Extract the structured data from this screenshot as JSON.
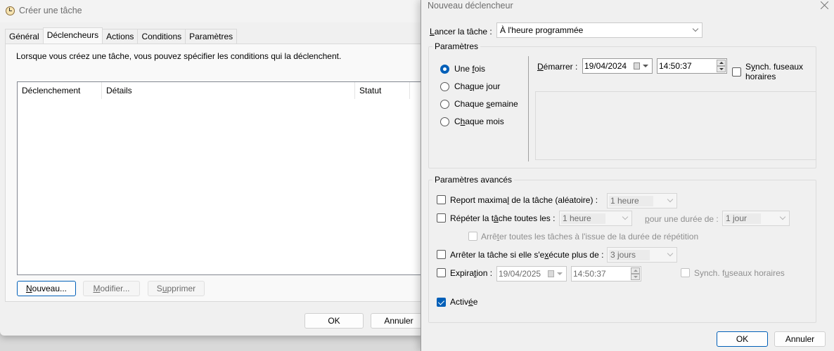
{
  "create_task_window": {
    "title": "Créer une tâche",
    "tabs": [
      {
        "label": "Général",
        "active": false
      },
      {
        "label": "Déclencheurs",
        "active": true
      },
      {
        "label": "Actions",
        "active": false
      },
      {
        "label": "Conditions",
        "active": false
      },
      {
        "label": "Paramètres",
        "active": false
      }
    ],
    "description": "Lorsque vous créez une tâche, vous pouvez spécifier les conditions qui la déclenchent.",
    "table": {
      "columns": [
        "Déclenchement",
        "Détails",
        "Statut"
      ],
      "rows": []
    },
    "buttons": {
      "new": {
        "prefix": "",
        "mnemonic": "N",
        "rest": "ouveau..."
      },
      "edit": {
        "prefix": "",
        "mnemonic": "M",
        "rest": "odifier..."
      },
      "delete": {
        "prefix": "S",
        "mnemonic": "u",
        "rest": "pprimer"
      },
      "ok": "OK",
      "cancel": "Annuler"
    }
  },
  "new_trigger_dialog": {
    "title": "Nouveau déclencheur",
    "launch_label": {
      "prefix": "",
      "mnemonic": "L",
      "rest": "ancer la tâche :"
    },
    "launch_value": "À l'heure programmée",
    "settings_group": "Paramètres",
    "schedule_options": [
      {
        "prefix": "Une ",
        "mnemonic": "f",
        "rest": "ois",
        "checked": true
      },
      {
        "prefix": "Cha",
        "mnemonic": "q",
        "rest": "ue jour",
        "checked": false
      },
      {
        "prefix": "Chaque ",
        "mnemonic": "s",
        "rest": "emaine",
        "checked": false
      },
      {
        "prefix": "C",
        "mnemonic": "h",
        "rest": "aque mois",
        "checked": false
      }
    ],
    "start_label": {
      "prefix": "",
      "mnemonic": "D",
      "rest": "émarrer :"
    },
    "start_date": "19/04/2024",
    "start_time": "14:50:37",
    "sync_timezones": {
      "prefix": "S",
      "mnemonic": "y",
      "rest": "nch. fuseaux",
      "line2": "horaires",
      "checked": false
    },
    "advanced_group": "Paramètres avancés",
    "advanced": {
      "max_delay": {
        "prefix": "Report maxima",
        "mnemonic": "l",
        "rest": " de la tâche (aléatoire) :",
        "checked": false,
        "value": "1 heure"
      },
      "repeat": {
        "prefix": "Répéter la t",
        "mnemonic": "â",
        "rest": "che toutes les :",
        "checked": false,
        "value": "1 heure"
      },
      "repeat_duration": {
        "prefix": "",
        "mnemonic": "p",
        "rest": "our une durée de :",
        "value": "1 jour"
      },
      "stop_all": {
        "prefix": "Arrê",
        "mnemonic": "t",
        "rest": "er toutes les tâches à l'issue de la durée de répétition",
        "checked": false
      },
      "stop_if_runs": {
        "prefix": "Arrêter la tâche si elle s'e",
        "mnemonic": "x",
        "rest": "écute plus de :",
        "checked": false,
        "value": "3 jours"
      },
      "expiration": {
        "prefix": "Expira",
        "mnemonic": "t",
        "rest": "ion :",
        "checked": false,
        "date": "19/04/2025",
        "time": "14:50:37"
      },
      "expiration_sync": {
        "prefix": "Synch. f",
        "mnemonic": "u",
        "rest": "seaux horaires",
        "checked": false
      },
      "enabled": {
        "prefix": "Activ",
        "mnemonic": "é",
        "rest": "e",
        "checked": true
      }
    },
    "ok": "OK",
    "cancel": "Annuler"
  },
  "colors": {
    "accent": "#005fb8",
    "window_bg": "#f0f0f0",
    "disabled_text": "#8f8f8f"
  }
}
